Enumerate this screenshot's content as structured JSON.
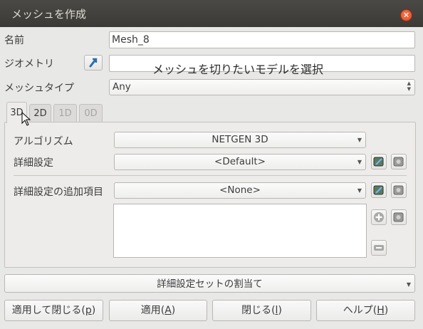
{
  "window": {
    "title": "メッシュを作成",
    "close_glyph": "✕"
  },
  "form": {
    "name_label": "名前",
    "name_value": "Mesh_8",
    "geometry_label": "ジオメトリ",
    "geometry_overlay_text": "メッシュを切りたいモデルを選択",
    "mesh_type_label": "メッシュタイプ",
    "mesh_type_value": "Any"
  },
  "tabs": [
    {
      "label": "3D",
      "active": true
    },
    {
      "label": "2D",
      "active": false
    },
    {
      "label": "1D",
      "active": false
    },
    {
      "label": "0D",
      "active": false
    }
  ],
  "panel": {
    "algorithm_label": "アルゴリズム",
    "algorithm_value": "NETGEN 3D",
    "hypothesis_label": "詳細設定",
    "hypothesis_value": "<Default>",
    "additional_label": "詳細設定の追加項目",
    "additional_value": "<None>"
  },
  "assign_set_label": "詳細設定セットの割当て",
  "buttons": {
    "apply_close_prefix": "適用して閉じる(",
    "apply_close_key": "p",
    "apply_close_suffix": ")",
    "apply_prefix": "適用(",
    "apply_key": "A",
    "apply_suffix": ")",
    "close_prefix": "閉じる(",
    "close_key": "l",
    "close_suffix": ")",
    "help_prefix": "ヘルプ(",
    "help_key": "H",
    "help_suffix": ")"
  },
  "colors": {
    "titlebar": "#3b3a36",
    "close": "#e2491e",
    "accent_icon": "#2a6fb0"
  }
}
